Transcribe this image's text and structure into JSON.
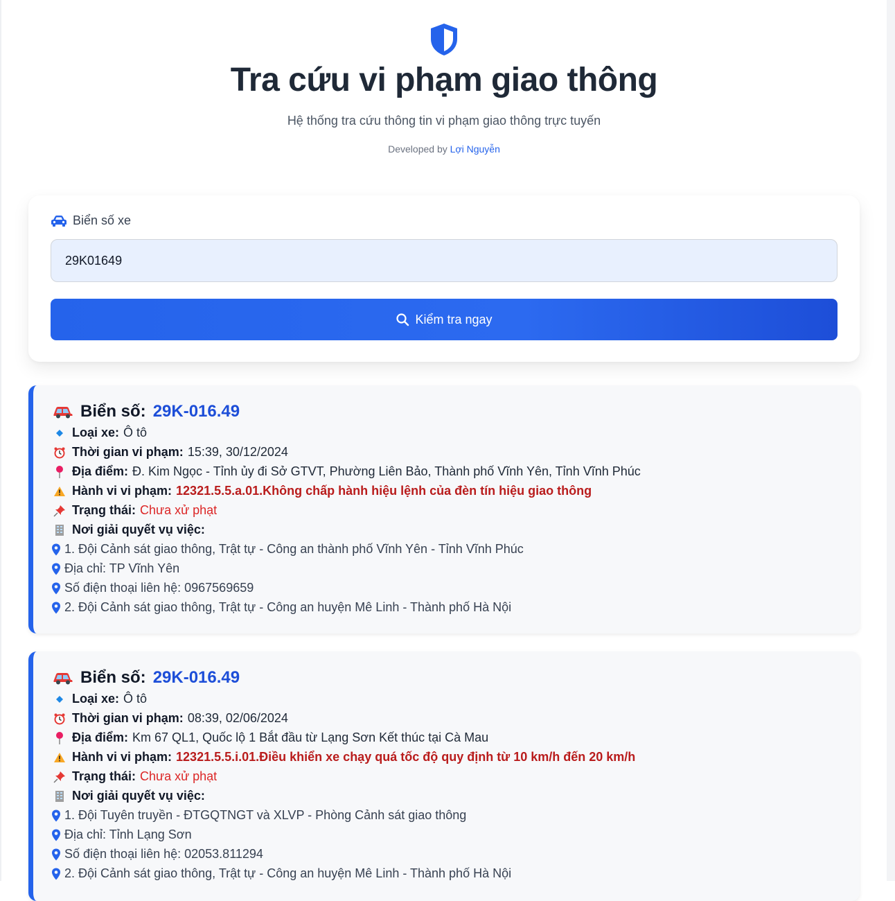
{
  "header": {
    "title": "Tra cứu vi phạm giao thông",
    "subtitle": "Hệ thống tra cứu thông tin vi phạm giao thông trực tuyến",
    "developed_by": "Developed by",
    "author": "Lợi Nguyễn",
    "icon": "shield-icon"
  },
  "search": {
    "label": "Biển số xe",
    "label_icon": "car-icon",
    "value": "29K01649",
    "button_label": "Kiểm tra ngay",
    "button_icon": "search-icon"
  },
  "results": [
    {
      "plate_label": "Biển số:",
      "plate": "29K-016.49",
      "vehicle_label": "Loại xe:",
      "vehicle": "Ô tô",
      "time_label": "Thời gian vi phạm:",
      "time": "15:39, 30/12/2024",
      "place_label": "Địa điểm:",
      "place": "Đ. Kim Ngọc - Tỉnh ủy đi Sở GTVT, Phường Liên Bảo, Thành phố Vĩnh Yên, Tỉnh Vĩnh Phúc",
      "violation_label": "Hành vi vi phạm:",
      "violation": "12321.5.5.a.01.Không chấp hành hiệu lệnh của đèn tín hiệu giao thông",
      "status_label": "Trạng thái:",
      "status": "Chưa xử phạt",
      "resolve_label": "Nơi giải quyết vụ việc:",
      "resolve_lines": [
        "1. Đội Cảnh sát giao thông, Trật tự - Công an thành phố Vĩnh Yên - Tỉnh Vĩnh Phúc",
        "Địa chỉ: TP Vĩnh Yên",
        "Số điện thoại liên hệ: 0967569659",
        "2. Đội Cảnh sát giao thông, Trật tự - Công an huyện Mê Linh - Thành phố Hà Nội"
      ]
    },
    {
      "plate_label": "Biển số:",
      "plate": "29K-016.49",
      "vehicle_label": "Loại xe:",
      "vehicle": "Ô tô",
      "time_label": "Thời gian vi phạm:",
      "time": "08:39, 02/06/2024",
      "place_label": "Địa điểm:",
      "place": "Km 67 QL1, Quốc lộ 1 Bắt đầu từ Lạng Sơn Kết thúc tại Cà Mau",
      "violation_label": "Hành vi vi phạm:",
      "violation": "12321.5.5.i.01.Điều khiển xe chạy quá tốc độ quy định từ 10 km/h đến 20 km/h",
      "status_label": "Trạng thái:",
      "status": "Chưa xử phạt",
      "resolve_label": "Nơi giải quyết vụ việc:",
      "resolve_lines": [
        "1. Đội Tuyên truyền - ĐTGQTNGT và XLVP - Phòng Cảnh sát giao thông",
        "Địa chỉ: Tỉnh Lạng Sơn",
        "Số điện thoại liên hệ: 02053.811294",
        "2. Đội Cảnh sát giao thông, Trật tự - Công an huyện Mê Linh - Thành phố Hà Nội"
      ]
    }
  ],
  "colors": {
    "accent": "#2563eb",
    "violation": "#b91c1c",
    "status": "#dc2626"
  }
}
